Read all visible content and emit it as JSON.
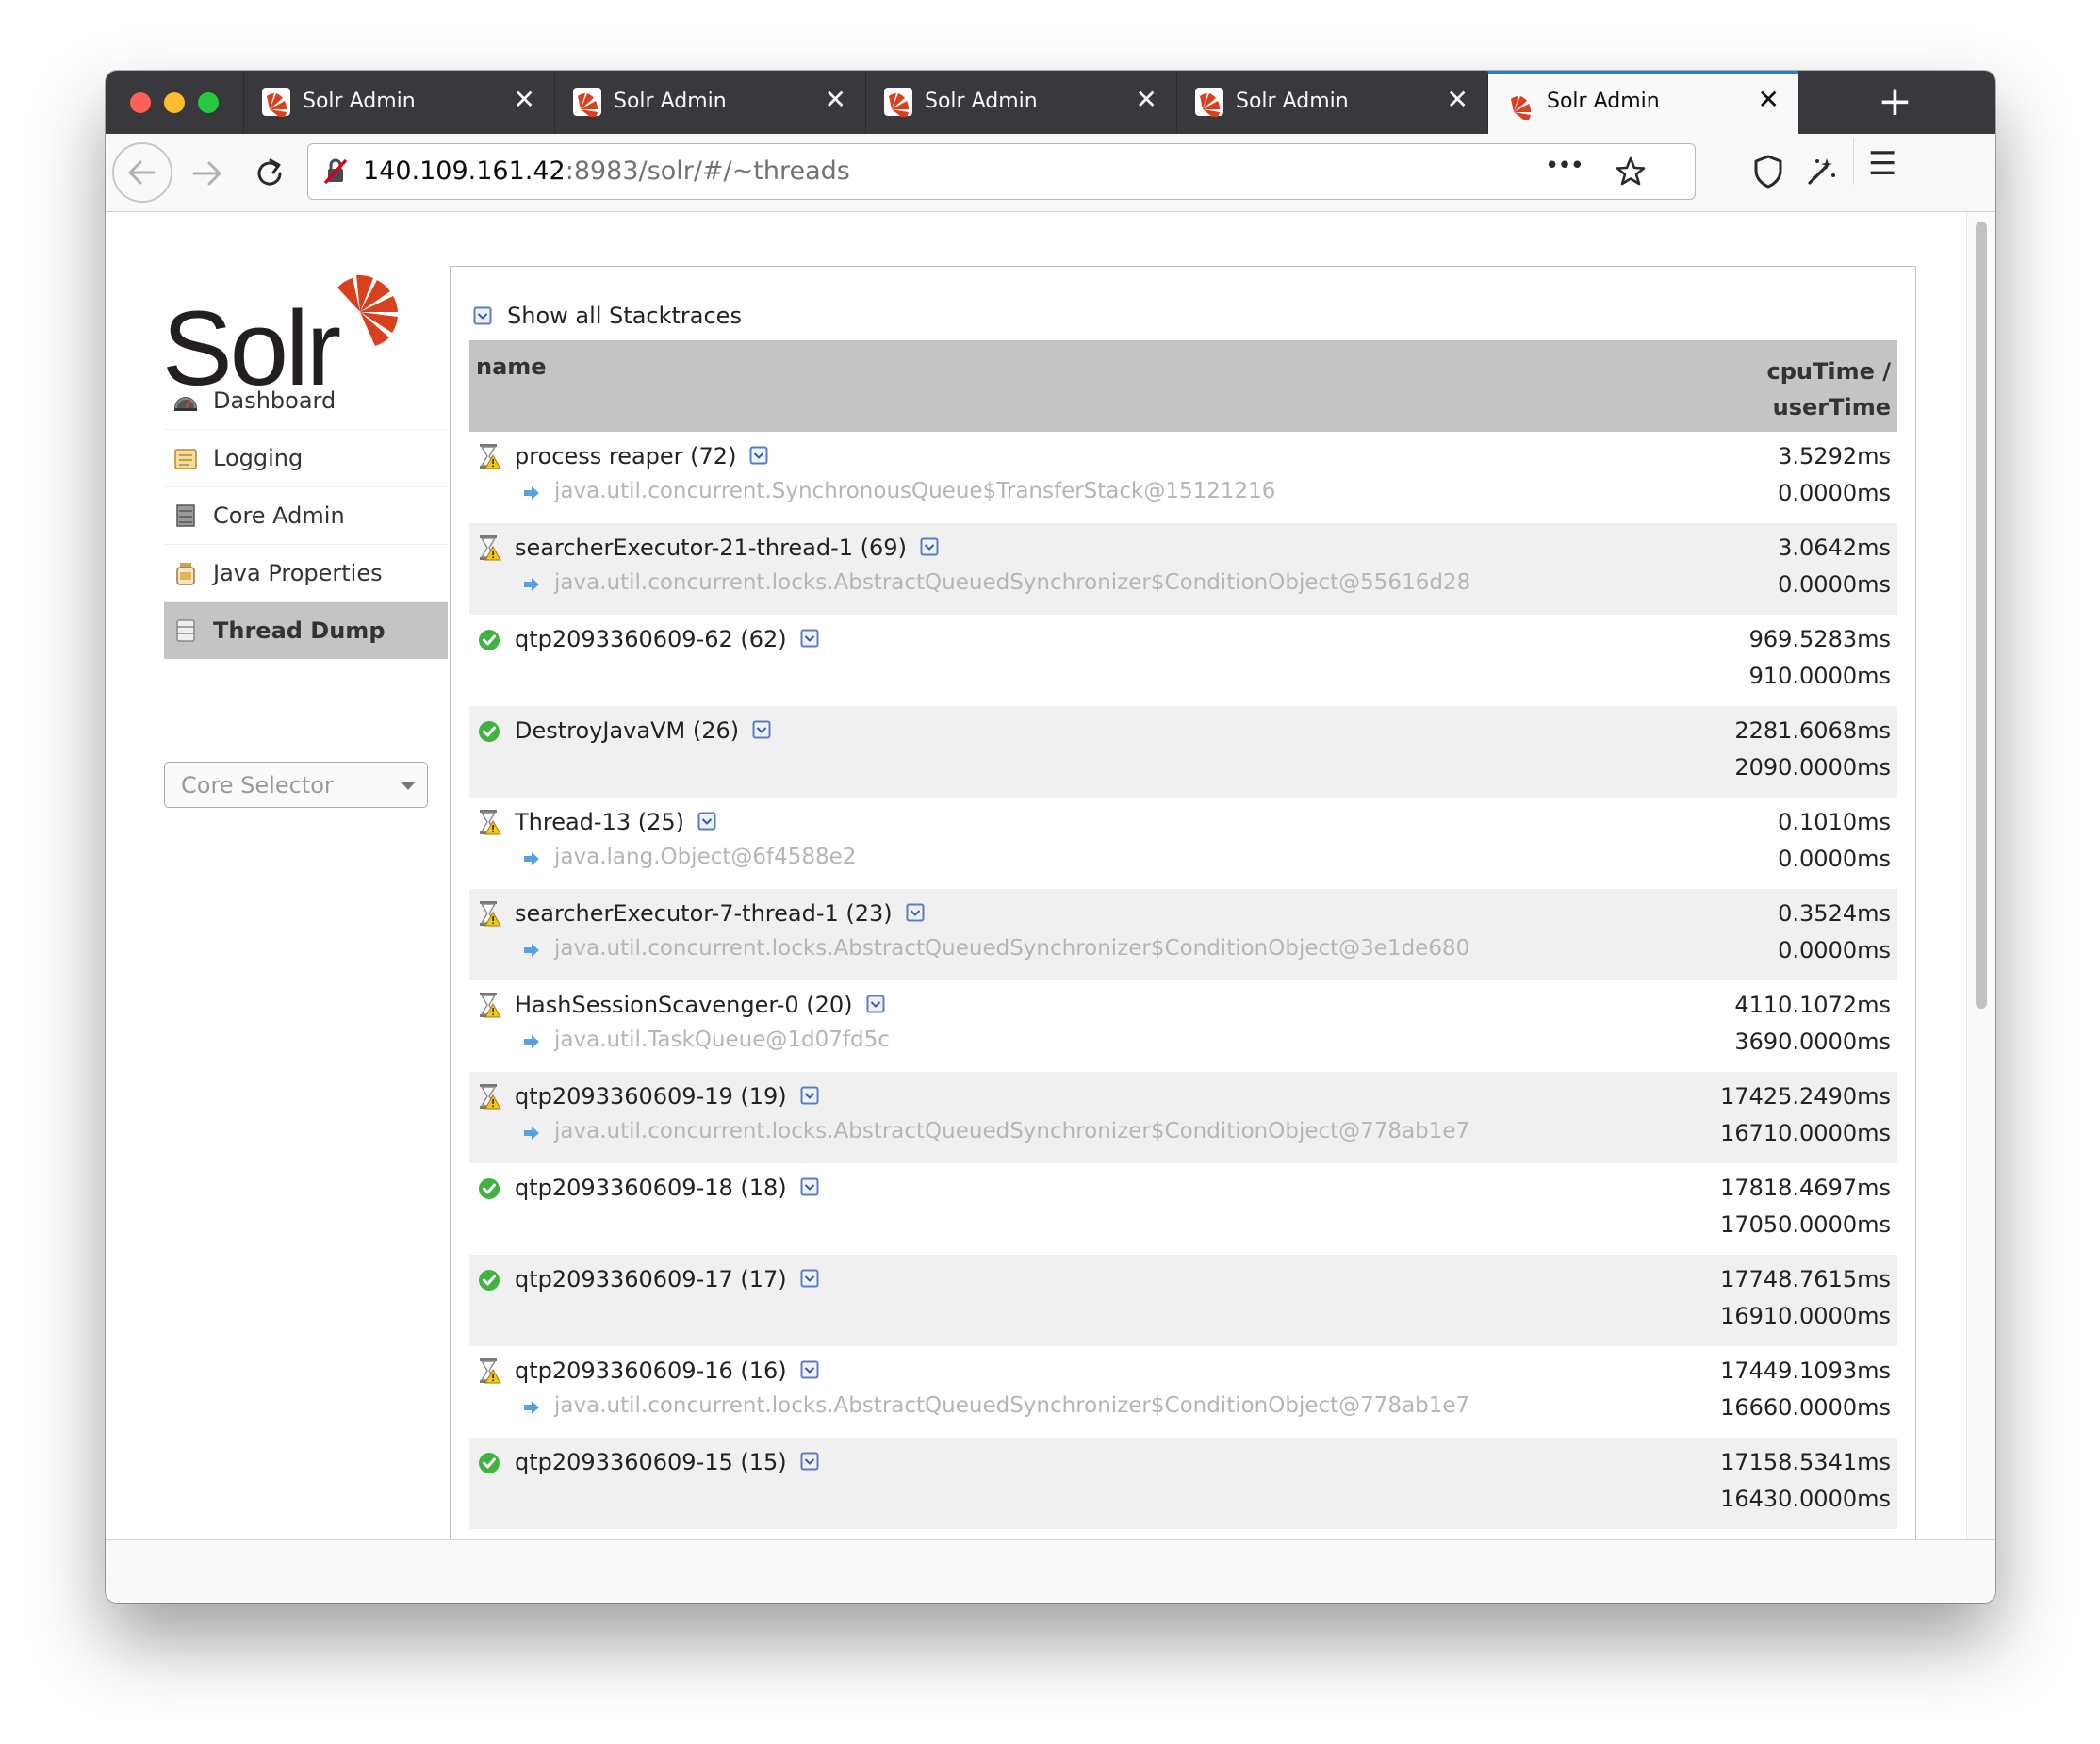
{
  "browser": {
    "tabs": [
      {
        "title": "Solr Admin",
        "active": false
      },
      {
        "title": "Solr Admin",
        "active": false
      },
      {
        "title": "Solr Admin",
        "active": false
      },
      {
        "title": "Solr Admin",
        "active": false
      },
      {
        "title": "Solr Admin",
        "active": true
      }
    ],
    "url_host": "140.109.161.42",
    "url_rest": ":8983/solr/#/~threads",
    "new_tab_glyph": "+",
    "tab_close_glyph": "✕",
    "overflow_glyph": "•••",
    "menu_glyph": "☰",
    "colors": {
      "tab_strip": "#38383d",
      "active_tab_accent": "#0a84ff"
    }
  },
  "sidebar": {
    "items": [
      {
        "label": "Dashboard",
        "icon": "dashboard-icon",
        "active": false
      },
      {
        "label": "Logging",
        "icon": "logging-icon",
        "active": false
      },
      {
        "label": "Core Admin",
        "icon": "core-admin-icon",
        "active": false
      },
      {
        "label": "Java Properties",
        "icon": "java-properties-icon",
        "active": false
      },
      {
        "label": "Thread Dump",
        "icon": "thread-dump-icon",
        "active": true
      }
    ],
    "core_selector": "Core Selector"
  },
  "threads": {
    "toggle_all_label": "Show all Stacktraces",
    "header": {
      "name": "name",
      "time_line1": "cpuTime /",
      "time_line2": "userTime"
    },
    "rows": [
      {
        "name": "process reaper (72)",
        "state": "waiting",
        "lock": "java.util.concurrent.SynchronousQueue$TransferStack@15121216",
        "cpu": "3.5292ms",
        "user": "0.0000ms"
      },
      {
        "name": "searcherExecutor-21-thread-1 (69)",
        "state": "waiting",
        "lock": "java.util.concurrent.locks.AbstractQueuedSynchronizer$ConditionObject@55616d28",
        "cpu": "3.0642ms",
        "user": "0.0000ms"
      },
      {
        "name": "qtp2093360609-62 (62)",
        "state": "runnable",
        "lock": "",
        "cpu": "969.5283ms",
        "user": "910.0000ms"
      },
      {
        "name": "DestroyJavaVM (26)",
        "state": "runnable",
        "lock": "",
        "cpu": "2281.6068ms",
        "user": "2090.0000ms"
      },
      {
        "name": "Thread-13 (25)",
        "state": "waiting",
        "lock": "java.lang.Object@6f4588e2",
        "cpu": "0.1010ms",
        "user": "0.0000ms"
      },
      {
        "name": "searcherExecutor-7-thread-1 (23)",
        "state": "waiting",
        "lock": "java.util.concurrent.locks.AbstractQueuedSynchronizer$ConditionObject@3e1de680",
        "cpu": "0.3524ms",
        "user": "0.0000ms"
      },
      {
        "name": "HashSessionScavenger-0 (20)",
        "state": "waiting",
        "lock": "java.util.TaskQueue@1d07fd5c",
        "cpu": "4110.1072ms",
        "user": "3690.0000ms"
      },
      {
        "name": "qtp2093360609-19 (19)",
        "state": "waiting",
        "lock": "java.util.concurrent.locks.AbstractQueuedSynchronizer$ConditionObject@778ab1e7",
        "cpu": "17425.2490ms",
        "user": "16710.0000ms"
      },
      {
        "name": "qtp2093360609-18 (18)",
        "state": "runnable",
        "lock": "",
        "cpu": "17818.4697ms",
        "user": "17050.0000ms"
      },
      {
        "name": "qtp2093360609-17 (17)",
        "state": "runnable",
        "lock": "",
        "cpu": "17748.7615ms",
        "user": "16910.0000ms"
      },
      {
        "name": "qtp2093360609-16 (16)",
        "state": "waiting",
        "lock": "java.util.concurrent.locks.AbstractQueuedSynchronizer$ConditionObject@778ab1e7",
        "cpu": "17449.1093ms",
        "user": "16660.0000ms"
      },
      {
        "name": "qtp2093360609-15 (15)",
        "state": "runnable",
        "lock": "",
        "cpu": "17158.5341ms",
        "user": "16430.0000ms"
      }
    ]
  }
}
